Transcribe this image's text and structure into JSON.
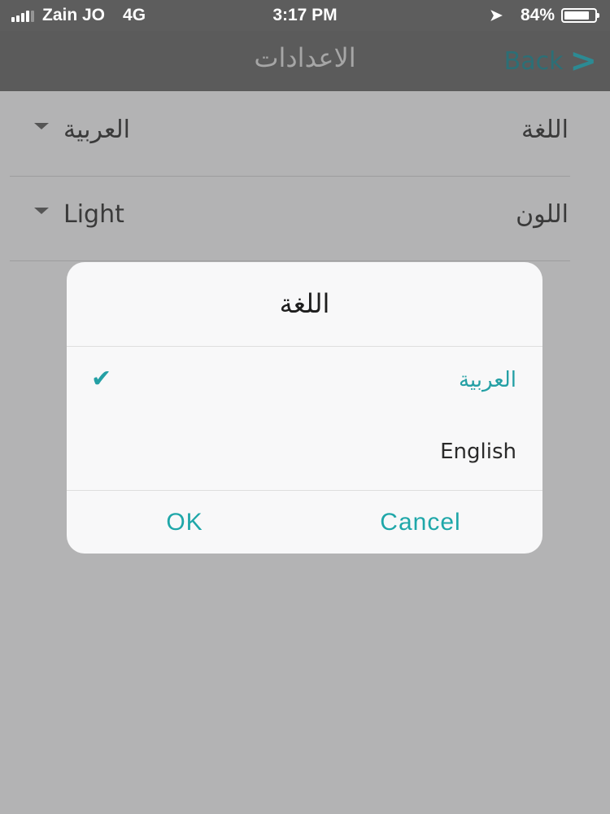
{
  "status_bar": {
    "carrier": "Zain JO",
    "network": "4G",
    "time": "3:17 PM",
    "battery_percent": "84%",
    "battery_level": 0.84,
    "location_icon": "location-arrow-icon"
  },
  "nav": {
    "title": "الاعدادات",
    "back_label": "Back",
    "back_icon": "chevron-right-icon"
  },
  "settings": {
    "rows": [
      {
        "label": "اللغة",
        "value": "العربية"
      },
      {
        "label": "اللون",
        "value": "Light"
      }
    ]
  },
  "dialog": {
    "title": "اللغة",
    "options": [
      {
        "label": "العربية",
        "selected": true
      },
      {
        "label": "English",
        "selected": false
      }
    ],
    "ok_label": "OK",
    "cancel_label": "Cancel"
  },
  "colors": {
    "accent": "#1fa7a9",
    "check": "#24a0a5",
    "overlay": "#b3b3b4",
    "bar": "#5b5b5b"
  }
}
